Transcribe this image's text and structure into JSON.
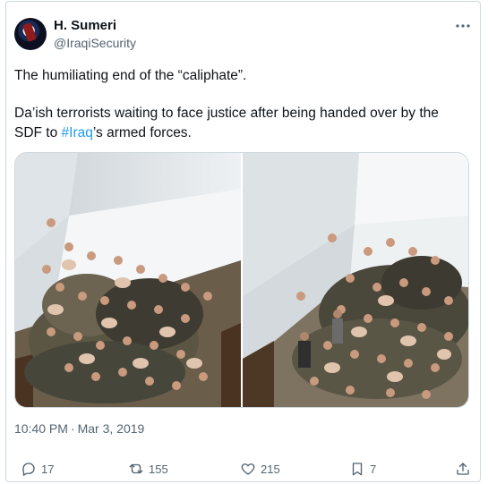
{
  "author": {
    "display_name": "H. Sumeri",
    "handle": "@IraqiSecurity",
    "avatar_icon": "avatar-logo"
  },
  "more_icon": "more-icon",
  "post": {
    "line1": "The humiliating end of the “caliphate”.",
    "line2_before": "Da’ish terrorists waiting to face justice after being handed over by the SDF to ",
    "hashtag": "#Iraq",
    "line2_after": "’s armed forces."
  },
  "meta": {
    "time": "10:40 PM",
    "separator": "·",
    "date": "Mar 3, 2019"
  },
  "actions": {
    "replies": "17",
    "reposts": "155",
    "likes": "215",
    "bookmarks": "7"
  },
  "colors": {
    "link": "#1d9bf0",
    "secondary_text": "#536471",
    "border": "#cfd9de"
  }
}
